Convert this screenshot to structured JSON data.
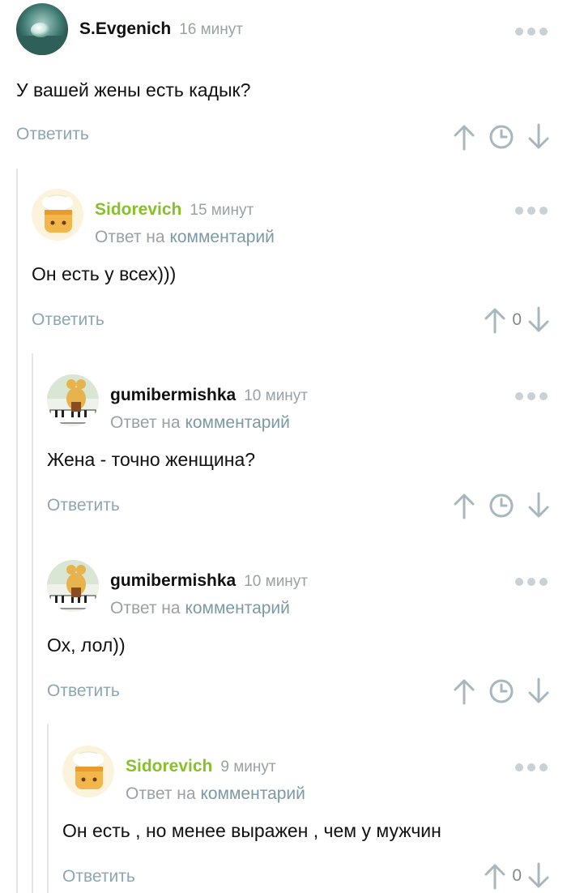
{
  "comments": [
    {
      "author": "S.Evgenich",
      "time": "16 минут",
      "text": "У вашей жены есть кадык?",
      "reply_label": "Ответить",
      "avatar": "water-drop-avatar"
    },
    {
      "author": "Sidorevich",
      "time": "15 минут",
      "reply_prefix": "Ответ на",
      "reply_link": "комментарий",
      "text": "Он есть у всех)))",
      "reply_label": "Ответить",
      "rating": "0",
      "avatar": "chef-bread-avatar",
      "author_color": "#87c02b"
    },
    {
      "author": "gumibermishka",
      "time": "10 минут",
      "reply_prefix": "Ответ на",
      "reply_link": "комментарий",
      "text": "Жена - точно женщина?",
      "reply_label": "Ответить",
      "avatar": "bear-piano-avatar"
    },
    {
      "author": "gumibermishka",
      "time": "10 минут",
      "reply_prefix": "Ответ на",
      "reply_link": "комментарий",
      "text": "Ох, лол))",
      "reply_label": "Ответить",
      "avatar": "bear-piano-avatar"
    },
    {
      "author": "Sidorevich",
      "time": "9 минут",
      "reply_prefix": "Ответ на",
      "reply_link": "комментарий",
      "text": "Он есть , но менее выражен , чем у мужчин",
      "reply_label": "Ответить",
      "rating": "0",
      "avatar": "chef-bread-avatar",
      "author_color": "#87c02b"
    }
  ],
  "colors": {
    "accent_green": "#87c02b",
    "muted": "#9aa1a6",
    "link": "#7b9aa6",
    "icon": "#a7b7bd",
    "thread_line": "#e3e6e8"
  }
}
